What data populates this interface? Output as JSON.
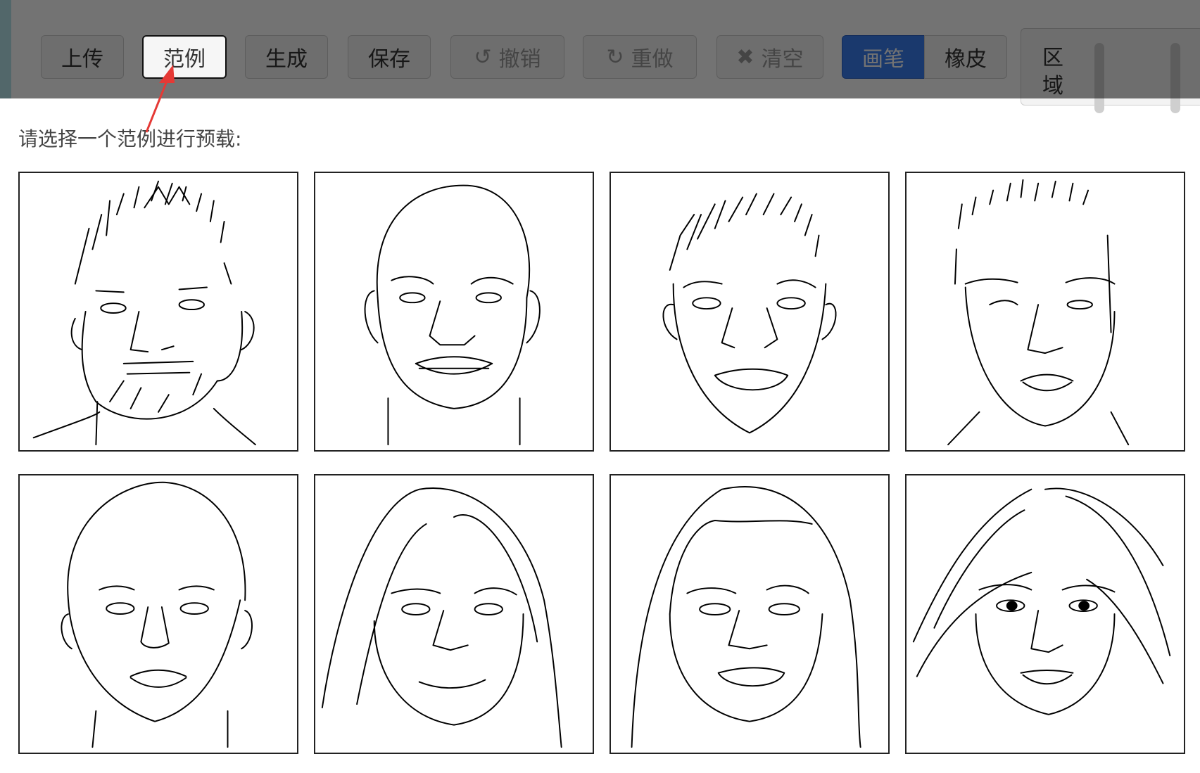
{
  "toolbar": {
    "upload": "上传",
    "example": "范例",
    "generate": "生成",
    "save": "保存",
    "undo": "撤销",
    "redo": "重做",
    "clear": "清空",
    "pen": "画笔",
    "eraser": "橡皮",
    "region": "区域"
  },
  "icons": {
    "undo": "undo-icon",
    "redo": "redo-icon",
    "clear": "close-icon"
  },
  "prompt": "请选择一个范例进行预载:",
  "colors": {
    "pen_active": "#3a7ff2",
    "arrow": "#e53935"
  }
}
